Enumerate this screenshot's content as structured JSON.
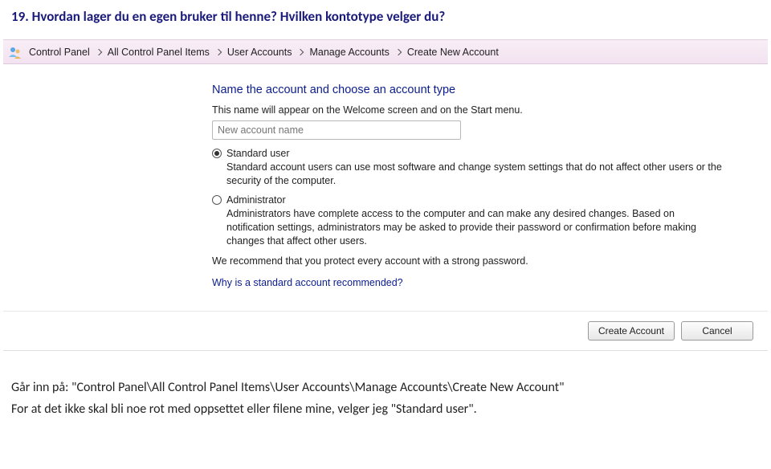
{
  "question": "19. Hvordan lager du en egen bruker til henne? Hvilken kontotype velger du?",
  "breadcrumb": {
    "items": [
      "Control Panel",
      "All Control Panel Items",
      "User Accounts",
      "Manage Accounts",
      "Create New Account"
    ]
  },
  "panel": {
    "title": "Name the account and choose an account type",
    "description": "This name will appear on the Welcome screen and on the Start menu.",
    "placeholder": "New account name",
    "standard": {
      "label": "Standard user",
      "desc": "Standard account users can use most software and change system settings that do not affect other users or the security of the computer."
    },
    "admin": {
      "label": "Administrator",
      "desc": "Administrators have complete access to the computer and can make any desired changes. Based on notification settings, administrators may be asked to provide their password or confirmation before making changes that affect other users."
    },
    "recommend": "We recommend that you protect every account with a strong password.",
    "link": "Why is a standard account recommended?"
  },
  "buttons": {
    "create": "Create Account",
    "cancel": "Cancel"
  },
  "answer": {
    "line1": "Går inn på: \"Control Panel\\All Control Panel Items\\User Accounts\\Manage Accounts\\Create New Account\"",
    "line2": "For at det ikke skal bli noe rot med oppsettet eller filene mine, velger jeg \"Standard user\"."
  }
}
